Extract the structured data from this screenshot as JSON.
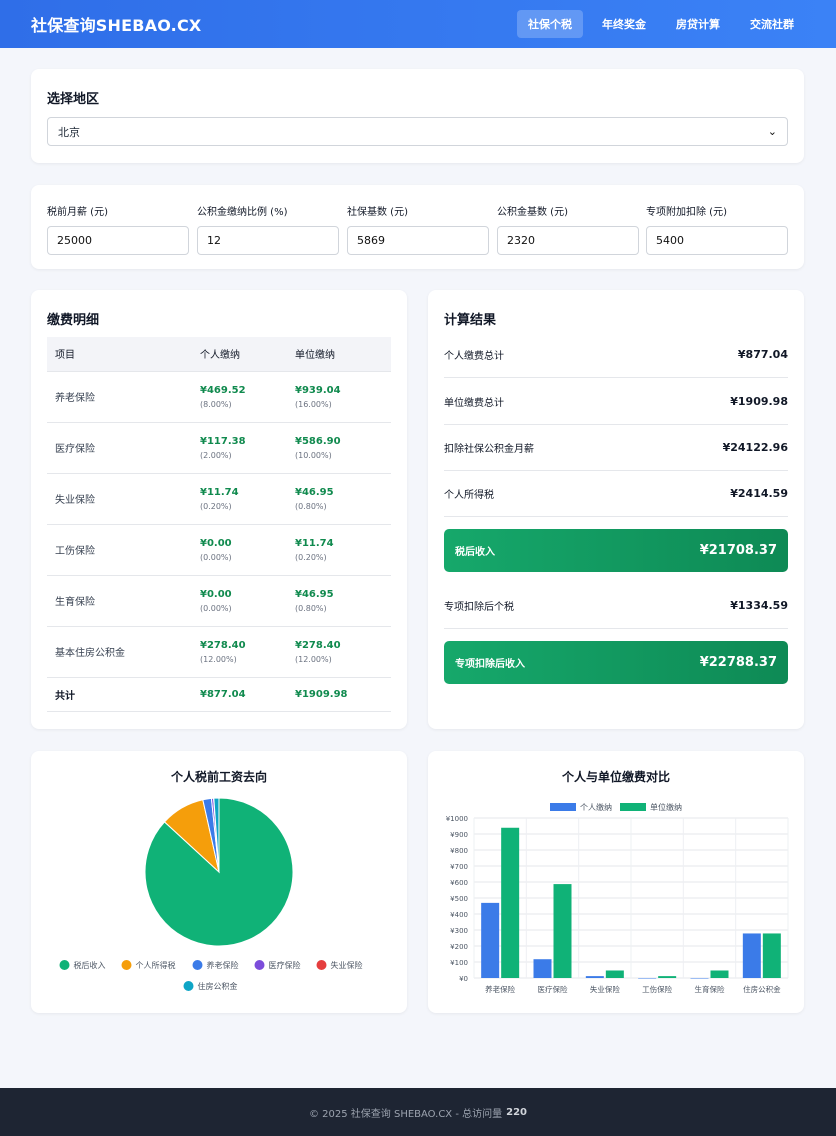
{
  "nav": {
    "brand": "社保查询SHEBAO.CX",
    "links": [
      {
        "label": "社保个税",
        "active": true
      },
      {
        "label": "年终奖金",
        "active": false
      },
      {
        "label": "房贷计算",
        "active": false
      },
      {
        "label": "交流社群",
        "active": false
      }
    ]
  },
  "region": {
    "title": "选择地区",
    "selected": "北京"
  },
  "inputs": [
    {
      "label": "税前月薪 (元)",
      "value": "25000"
    },
    {
      "label": "公积金缴纳比例 (%)",
      "value": "12"
    },
    {
      "label": "社保基数 (元)",
      "value": "5869"
    },
    {
      "label": "公积金基数 (元)",
      "value": "2320"
    },
    {
      "label": "专项附加扣除 (元)",
      "value": "5400"
    }
  ],
  "detail": {
    "title": "缴费明细",
    "headers": [
      "项目",
      "个人缴纳",
      "单位缴纳"
    ],
    "rows": [
      {
        "item": "养老保险",
        "personal": "¥469.52",
        "personal_pct": "(8.00%)",
        "company": "¥939.04",
        "company_pct": "(16.00%)"
      },
      {
        "item": "医疗保险",
        "personal": "¥117.38",
        "personal_pct": "(2.00%)",
        "company": "¥586.90",
        "company_pct": "(10.00%)"
      },
      {
        "item": "失业保险",
        "personal": "¥11.74",
        "personal_pct": "(0.20%)",
        "company": "¥46.95",
        "company_pct": "(0.80%)"
      },
      {
        "item": "工伤保险",
        "personal": "¥0.00",
        "personal_pct": "(0.00%)",
        "company": "¥11.74",
        "company_pct": "(0.20%)"
      },
      {
        "item": "生育保险",
        "personal": "¥0.00",
        "personal_pct": "(0.00%)",
        "company": "¥46.95",
        "company_pct": "(0.80%)"
      },
      {
        "item": "基本住房公积金",
        "personal": "¥278.40",
        "personal_pct": "(12.00%)",
        "company": "¥278.40",
        "company_pct": "(12.00%)"
      }
    ],
    "total": {
      "item": "共计",
      "personal": "¥877.04",
      "company": "¥1909.98"
    }
  },
  "result": {
    "title": "计算结果",
    "rows": [
      {
        "label": "个人缴费总计",
        "value": "¥877.04"
      },
      {
        "label": "单位缴费总计",
        "value": "¥1909.98"
      },
      {
        "label": "扣除社保公积金月薪",
        "value": "¥24122.96"
      },
      {
        "label": "个人所得税",
        "value": "¥2414.59"
      }
    ],
    "net_income": {
      "label": "税后收入",
      "value": "¥21708.37"
    },
    "special_tax": {
      "label": "专项扣除后个税",
      "value": "¥1334.59"
    },
    "special_income": {
      "label": "专项扣除后收入",
      "value": "¥22788.37"
    }
  },
  "chart_data": [
    {
      "type": "pie",
      "title": "个人税前工资去向",
      "legend_position": "bottom",
      "labels": [
        "税后收入",
        "个人所得税",
        "养老保险",
        "医疗保险",
        "失业保险",
        "住房公积金"
      ],
      "values": [
        21708.37,
        2414.59,
        469.52,
        117.38,
        11.74,
        278.4
      ],
      "colors": [
        "#10b277",
        "#f59e0b",
        "#3b7be8",
        "#7c4ddb",
        "#e53e3e",
        "#0ea5c6"
      ]
    },
    {
      "type": "bar",
      "title": "个人与单位缴费对比",
      "legend_position": "top",
      "categories": [
        "养老保险",
        "医疗保险",
        "失业保险",
        "工伤保险",
        "生育保险",
        "住房公积金"
      ],
      "series": [
        {
          "name": "个人缴纳",
          "color": "#3b7be8",
          "values": [
            469.52,
            117.38,
            11.74,
            0,
            0,
            278.4
          ]
        },
        {
          "name": "单位缴纳",
          "color": "#10b277",
          "values": [
            939.04,
            586.9,
            46.95,
            11.74,
            46.95,
            278.4
          ]
        }
      ],
      "yticks": [
        "¥0",
        "¥100",
        "¥200",
        "¥300",
        "¥400",
        "¥500",
        "¥600",
        "¥700",
        "¥800",
        "¥900",
        "¥1000"
      ],
      "ylim": [
        0,
        1000
      ],
      "grid": true
    }
  ],
  "footer": {
    "text": "© 2025 社保查询 SHEBAO.CX - 总访问量",
    "count": "220"
  }
}
